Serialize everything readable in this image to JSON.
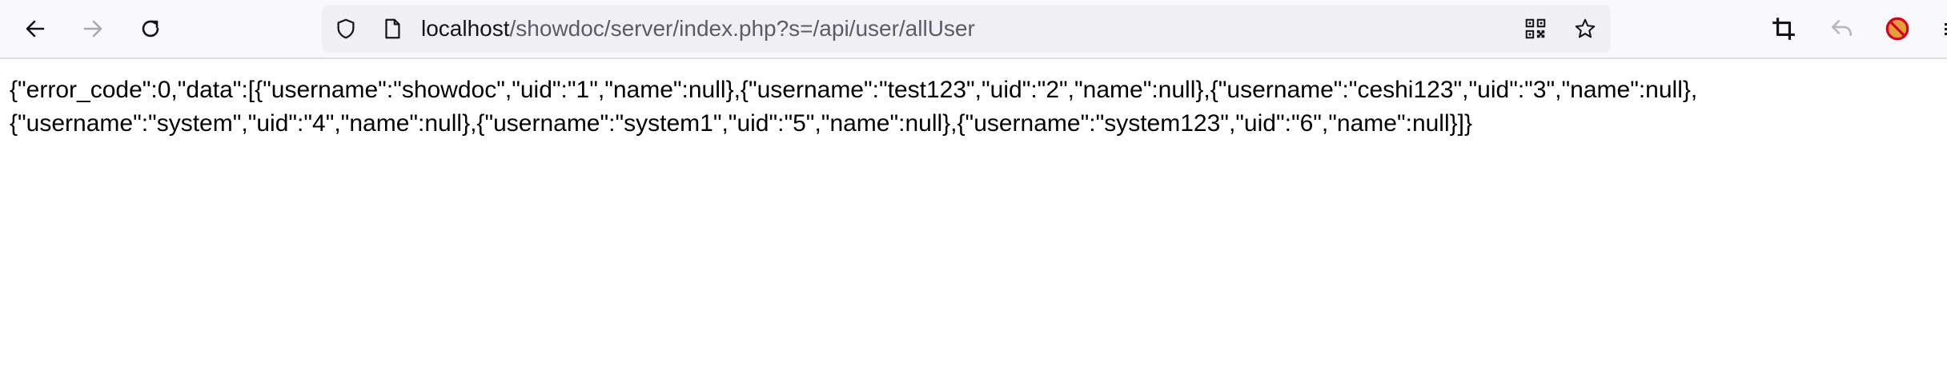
{
  "browser": {
    "url_host": "localhost",
    "url_path": "/showdoc/server/index.php?s=/api/user/allUser",
    "icons": {
      "back": "arrow-left-icon",
      "forward": "arrow-right-icon",
      "reload": "reload-icon",
      "shield": "shield-icon",
      "page": "page-icon",
      "qr": "qr-code-icon",
      "star": "star-icon",
      "crop": "crop-icon",
      "undo": "undo-icon",
      "addon": "blocked-addon-icon"
    }
  },
  "response": {
    "line1": "{\"error_code\":0,\"data\":[{\"username\":\"showdoc\",\"uid\":\"1\",\"name\":null},{\"username\":\"test123\",\"uid\":\"2\",\"name\":null},{\"username\":\"ceshi123\",\"uid\":\"3\",\"name\":null},",
    "line2": "{\"username\":\"system\",\"uid\":\"4\",\"name\":null},{\"username\":\"system1\",\"uid\":\"5\",\"name\":null},{\"username\":\"system123\",\"uid\":\"6\",\"name\":null}]}"
  },
  "colors": {
    "toolbar_bg": "#f9f9fb",
    "urlbar_bg": "#f0f0f4",
    "addon_red": "#d70022",
    "addon_orange": "#e3a03a"
  }
}
